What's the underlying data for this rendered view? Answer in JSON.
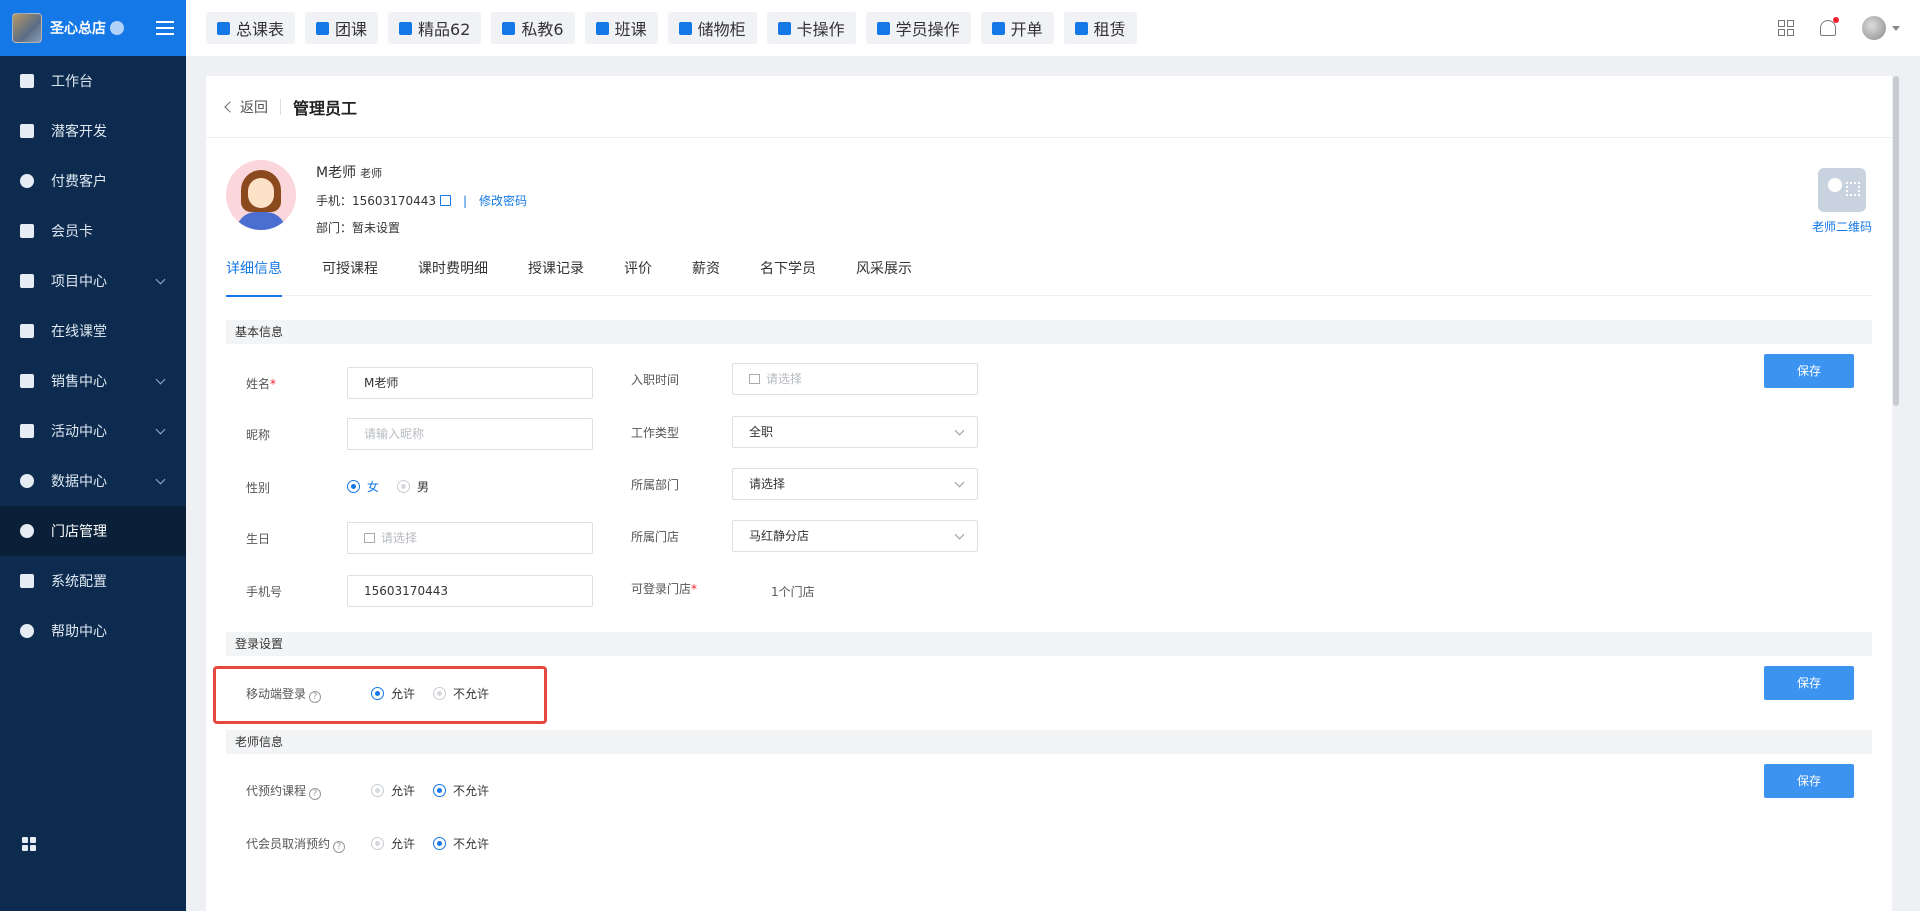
{
  "brand": {
    "name": "圣心总店"
  },
  "sidebar": {
    "items": [
      {
        "label": "工作台",
        "chevron": false
      },
      {
        "label": "潜客开发",
        "chevron": false
      },
      {
        "label": "付费客户",
        "chevron": false
      },
      {
        "label": "会员卡",
        "chevron": false
      },
      {
        "label": "项目中心",
        "chevron": true
      },
      {
        "label": "在线课堂",
        "chevron": false
      },
      {
        "label": "销售中心",
        "chevron": true
      },
      {
        "label": "活动中心",
        "chevron": true
      },
      {
        "label": "数据中心",
        "chevron": true
      },
      {
        "label": "门店管理",
        "chevron": false,
        "active": true
      },
      {
        "label": "系统配置",
        "chevron": false
      },
      {
        "label": "帮助中心",
        "chevron": false
      }
    ]
  },
  "topbar": {
    "tabs": [
      "总课表",
      "团课",
      "精品62",
      "私教6",
      "班课",
      "储物柜",
      "卡操作",
      "学员操作",
      "开单",
      "租赁"
    ]
  },
  "header": {
    "back": "返回",
    "title": "管理员工"
  },
  "profile": {
    "name": "M老师",
    "role": "老师",
    "phone_label": "手机：",
    "phone": "15603170443",
    "sep": "|",
    "change_pwd": "修改密码",
    "dept_label": "部门：",
    "dept": "暂未设置",
    "qr_label": "老师二维码"
  },
  "tabs": [
    "详细信息",
    "可授课程",
    "课时费明细",
    "授课记录",
    "评价",
    "薪资",
    "名下学员",
    "风采展示"
  ],
  "basic": {
    "title": "基本信息",
    "name_label": "姓名",
    "req": "*",
    "name_value": "M老师",
    "nickname_label": "昵称",
    "nickname_placeholder": "请输入昵称",
    "gender_label": "性别",
    "gender_female": "女",
    "gender_male": "男",
    "birthday_label": "生日",
    "birthday_placeholder": "请选择",
    "phone_label": "手机号",
    "phone_value": "15603170443",
    "hire_label": "入职时间",
    "hire_placeholder": "请选择",
    "worktype_label": "工作类型",
    "worktype_value": "全职",
    "dept_label": "所属部门",
    "dept_value": "请选择",
    "store_label": "所属门店",
    "store_value": "马红静分店",
    "login_store_label": "可登录门店",
    "login_store_value": "1个门店",
    "save": "保存"
  },
  "login": {
    "title": "登录设置",
    "mobile_label": "移动端登录",
    "allow": "允许",
    "deny": "不允许",
    "save": "保存"
  },
  "teacher": {
    "title": "老师信息",
    "proxy_book_label": "代预约课程",
    "proxy_cancel_label": "代会员取消预约",
    "allow": "允许",
    "deny": "不允许",
    "save": "保存"
  },
  "colors": {
    "accent": "#1478e6",
    "sidebar": "#0d2b4e",
    "highlight": "#e5483e"
  }
}
